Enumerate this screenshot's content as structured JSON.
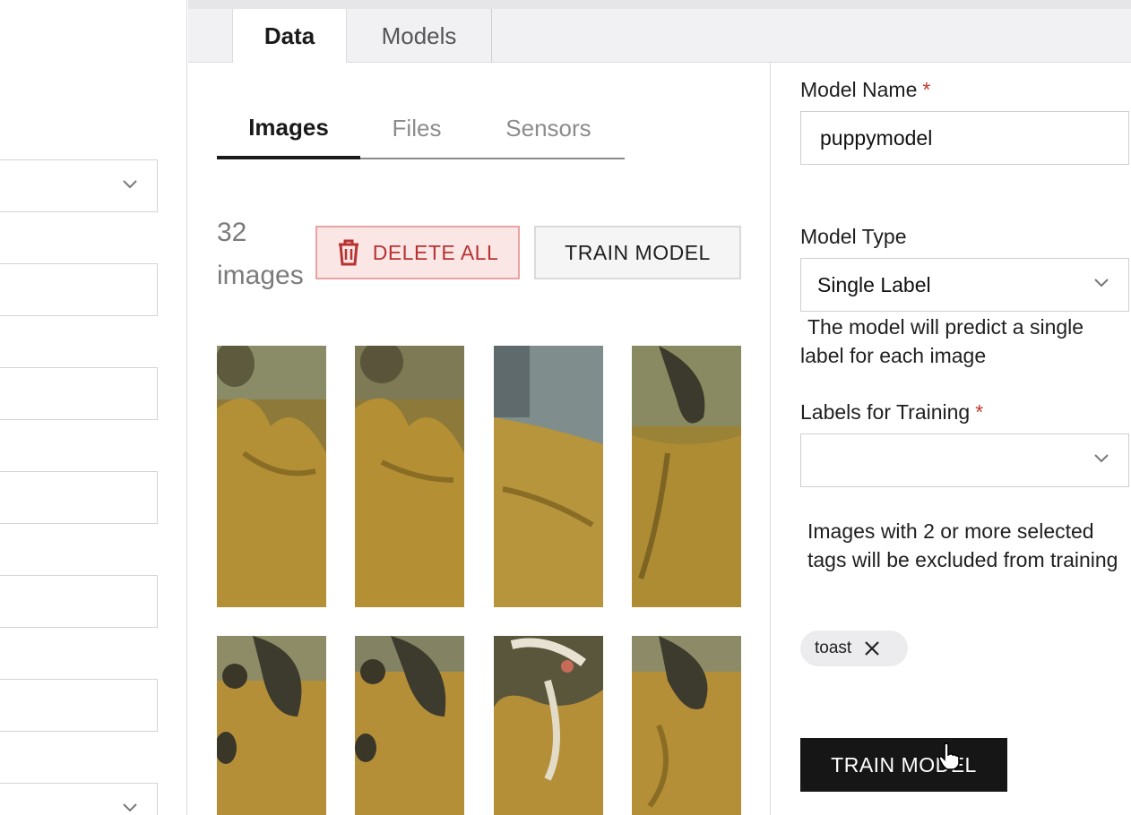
{
  "top_tabs": [
    {
      "label": "Data",
      "active": true
    },
    {
      "label": "Models",
      "active": false
    }
  ],
  "sub_tabs": [
    {
      "label": "Images",
      "active": true
    },
    {
      "label": "Files",
      "active": false
    },
    {
      "label": "Sensors",
      "active": false
    }
  ],
  "dataset": {
    "count_number": "32",
    "count_unit": "images",
    "delete_all_label": "DELETE ALL",
    "train_model_label": "TRAIN MODEL",
    "thumbnails_visible": 8
  },
  "model_form": {
    "name_label": "Model Name",
    "name_required": "*",
    "name_value": "puppymodel",
    "type_label": "Model Type",
    "type_value": "Single Label",
    "type_help": "The model will predict a single label for each image",
    "labels_label": "Labels for Training",
    "labels_required": "*",
    "labels_value": "",
    "labels_help": "Images with 2 or more selected tags will be excluded from training",
    "selected_tags": [
      "toast"
    ],
    "train_button_label": "TRAIN MODEL"
  },
  "icons": {
    "chevron": "chevron-down-icon",
    "trash": "trash-icon",
    "remove_tag": "close-icon",
    "cursor": "hand-pointer-icon"
  },
  "colors": {
    "delete_text": "#b83232",
    "delete_bg": "#fbe6e6",
    "required_star": "#c0392b",
    "primary_button": "#161616"
  }
}
